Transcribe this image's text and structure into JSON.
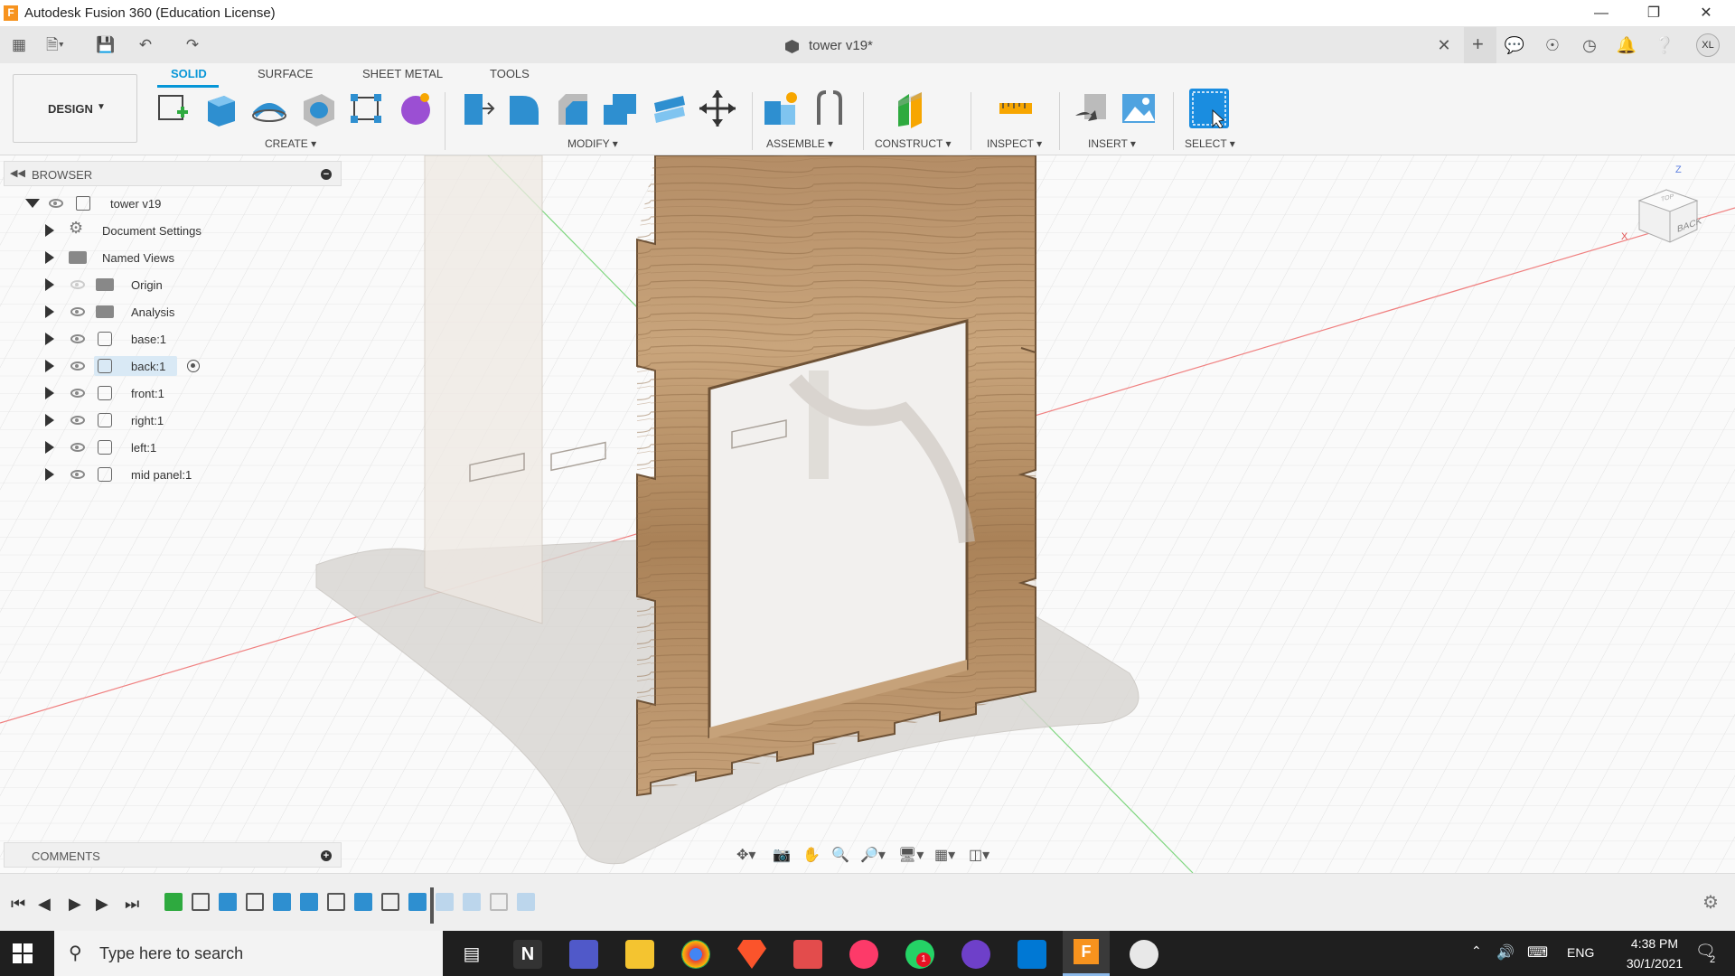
{
  "window": {
    "title": "Autodesk Fusion 360 (Education License)",
    "doc_title": "tower v19*"
  },
  "qat": {
    "user_initials": "XL"
  },
  "ribbon": {
    "workspace": "DESIGN",
    "tabs": [
      "SOLID",
      "SURFACE",
      "SHEET METAL",
      "TOOLS"
    ],
    "active_tab": "SOLID",
    "groups": [
      "CREATE",
      "MODIFY",
      "ASSEMBLE",
      "CONSTRUCT",
      "INSPECT",
      "INSERT",
      "SELECT"
    ]
  },
  "browser": {
    "header": "BROWSER",
    "root": "tower v19",
    "items": [
      {
        "label": "Document Settings",
        "icon": "gear-icon"
      },
      {
        "label": "Named Views",
        "icon": "folder-icon"
      },
      {
        "label": "Origin",
        "icon": "folder-icon"
      },
      {
        "label": "Analysis",
        "icon": "folder-icon"
      },
      {
        "label": "base:1",
        "icon": "body-icon"
      },
      {
        "label": "back:1",
        "icon": "body-icon",
        "active": true
      },
      {
        "label": "front:1",
        "icon": "body-icon"
      },
      {
        "label": "right:1",
        "icon": "body-icon"
      },
      {
        "label": "left:1",
        "icon": "body-icon"
      },
      {
        "label": "mid panel:1",
        "icon": "body-icon"
      }
    ]
  },
  "comments": {
    "header": "COMMENTS"
  },
  "viewcube": {
    "face_label": "BACK",
    "top_label": "TOP",
    "axis_z": "Z",
    "axis_x": "X"
  },
  "taskbar": {
    "search_placeholder": "Type here to search",
    "language": "ENG",
    "time": "4:38 PM",
    "date": "30/1/2021",
    "notifications": "2",
    "whatsapp_badge": "1"
  },
  "colors": {
    "accent": "#0696d7",
    "wood": "#b7916a",
    "taskbar": "#1f1f1f"
  }
}
